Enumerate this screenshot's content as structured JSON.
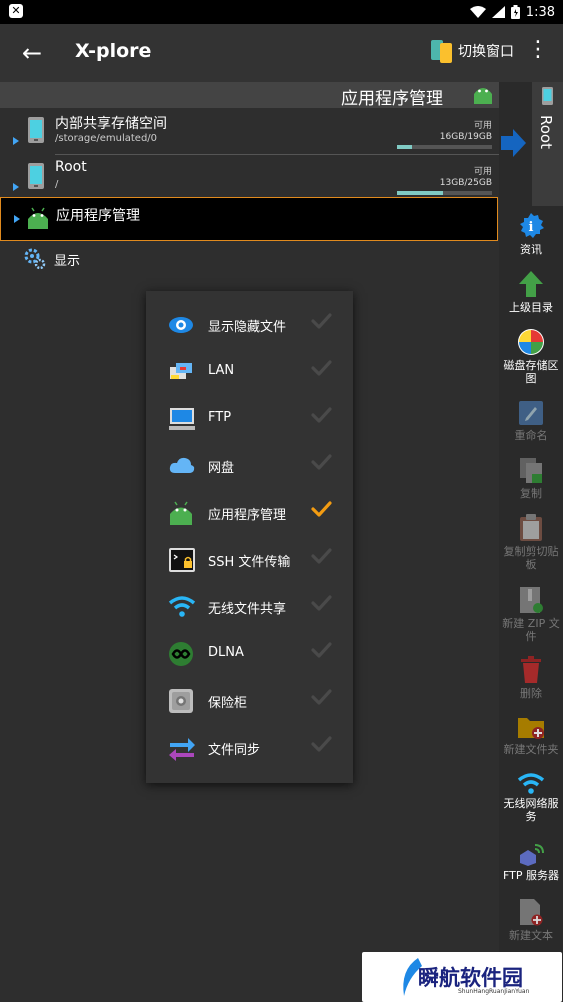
{
  "status_bar": {
    "time": "1:38"
  },
  "app_bar": {
    "title": "X-plore",
    "switch_window_label": "切换窗口"
  },
  "pane": {
    "header_label": "应用程序管理",
    "storage": [
      {
        "name": "内部共享存储空间",
        "path": "/storage/emulated/0",
        "available_label": "可用",
        "size": "16GB/19GB",
        "usage": 0.16
      },
      {
        "name": "Root",
        "path": "/",
        "available_label": "可用",
        "size": "13GB/25GB",
        "usage": 0.48
      }
    ],
    "app_manager_row": "应用程序管理",
    "display_row": "显示"
  },
  "root_tab": {
    "label": "Root"
  },
  "sidebar": {
    "items": [
      {
        "label": "资讯",
        "icon": "info-icon"
      },
      {
        "label": "上级目录",
        "icon": "up-arrow-icon"
      },
      {
        "label": "磁盘存储区图",
        "icon": "pie-chart-icon"
      },
      {
        "label": "重命名",
        "icon": "rename-icon"
      },
      {
        "label": "复制",
        "icon": "copy-icon"
      },
      {
        "label": "复制剪切贴板",
        "icon": "clipboard-icon"
      },
      {
        "label": "新建 ZIP 文件",
        "icon": "zip-icon"
      },
      {
        "label": "删除",
        "icon": "trash-icon"
      },
      {
        "label": "新建文件夹",
        "icon": "new-folder-icon"
      },
      {
        "label": "无线网络服务",
        "icon": "wifi-icon"
      },
      {
        "label": "FTP 服务器",
        "icon": "ftp-server-icon"
      },
      {
        "label": "新建文本",
        "icon": "new-text-icon"
      }
    ]
  },
  "show_menu": {
    "items": [
      {
        "label": "显示隐藏文件",
        "icon": "eye-icon",
        "checked": false
      },
      {
        "label": "LAN",
        "icon": "lan-icon",
        "checked": false
      },
      {
        "label": "FTP",
        "icon": "ftp-icon",
        "checked": false
      },
      {
        "label": "网盘",
        "icon": "cloud-icon",
        "checked": false
      },
      {
        "label": "应用程序管理",
        "icon": "android-icon",
        "checked": true
      },
      {
        "label": "SSH 文件传输",
        "icon": "ssh-icon",
        "checked": false
      },
      {
        "label": "无线文件共享",
        "icon": "wifi-icon",
        "checked": false
      },
      {
        "label": "DLNA",
        "icon": "dlna-icon",
        "checked": false
      },
      {
        "label": "保险柜",
        "icon": "vault-icon",
        "checked": false
      },
      {
        "label": "文件同步",
        "icon": "sync-icon",
        "checked": false
      }
    ]
  },
  "watermark": {
    "title": "瞬航软件园",
    "subtitle": "ShunHangRuanJianYuan"
  },
  "colors": {
    "accent": "#e08a1e",
    "checked": "#f39c12",
    "arrow_blue": "#1565c0",
    "android_green": "#4caf50"
  }
}
